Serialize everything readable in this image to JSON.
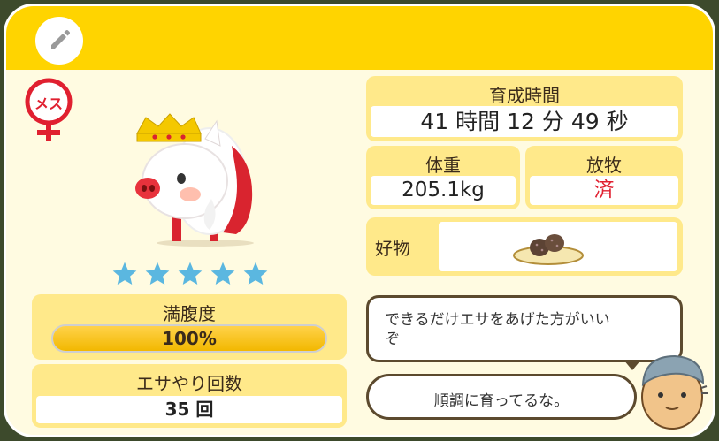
{
  "gender_badge": "メス",
  "stars": {
    "rating": 5,
    "max": 5
  },
  "growth_time": {
    "label": "育成時間",
    "value": "41 時間 12 分 49 秒"
  },
  "weight": {
    "label": "体重",
    "value": "205.1kg"
  },
  "grazing": {
    "label": "放牧",
    "value": "済"
  },
  "favorite": {
    "label": "好物"
  },
  "fullness": {
    "label": "満腹度",
    "value_text": "100%",
    "fraction": 1.0
  },
  "feeding_count": {
    "label": "エサやり回数",
    "value": "35 回"
  },
  "dialog": {
    "bubble1": "できるだけエサをあげた方がいい\nぞ",
    "bubble2": "順調に育ってるな。"
  },
  "colors": {
    "header": "#ffd400",
    "panel": "#fffbe1",
    "label_box": "#ffe98a",
    "accent_red": "#e02030",
    "star": "#5bb7e0"
  }
}
